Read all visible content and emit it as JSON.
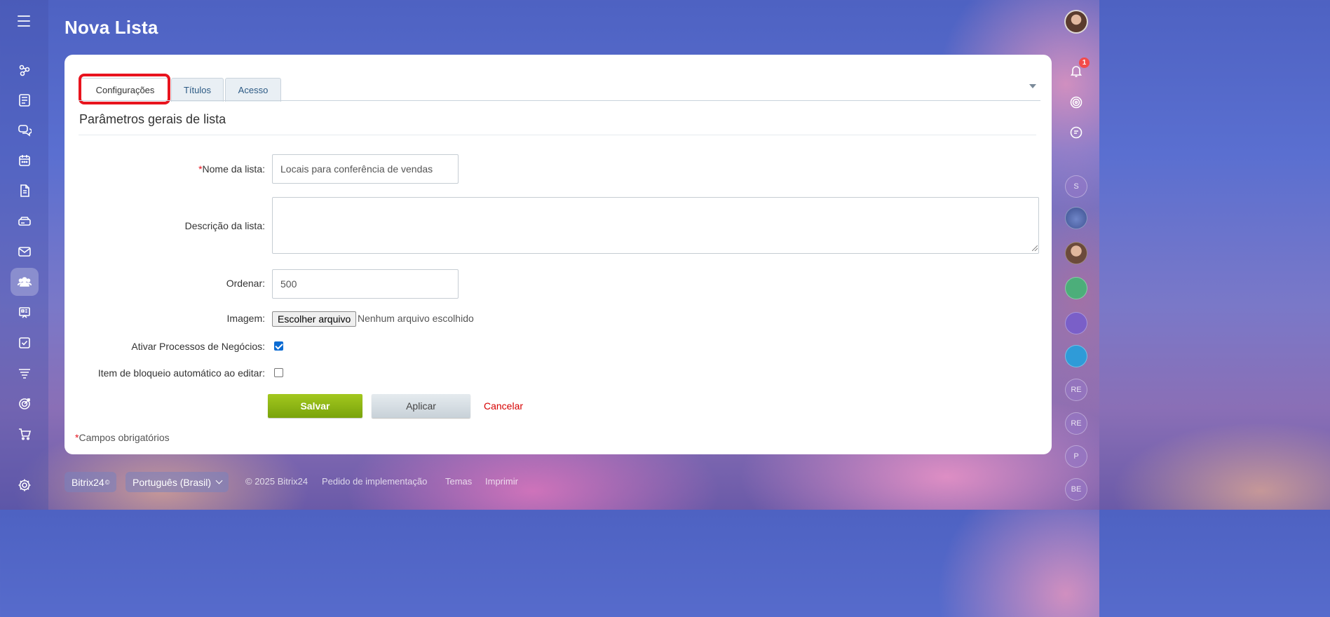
{
  "page": {
    "title": "Nova Lista"
  },
  "tabs": [
    {
      "label": "Configurações",
      "active": true
    },
    {
      "label": "Títulos",
      "active": false
    },
    {
      "label": "Acesso",
      "active": false
    }
  ],
  "section": {
    "title": "Parâmetros gerais de lista"
  },
  "form": {
    "name": {
      "required_mark": "*",
      "label": "Nome da lista:",
      "value": "Locais para conferência de vendas"
    },
    "description": {
      "label": "Descrição da lista:",
      "value": ""
    },
    "sort": {
      "label": "Ordenar:",
      "value": "500"
    },
    "image": {
      "label": "Imagem:",
      "button_label": "Escolher arquivo",
      "status": "Nenhum arquivo escolhido"
    },
    "bizproc": {
      "label": "Ativar Processos de Negócios:",
      "checked": true
    },
    "autolock": {
      "label": "Item de bloqueio automático ao editar:",
      "checked": false
    }
  },
  "buttons": {
    "save": "Salvar",
    "apply": "Aplicar",
    "cancel": "Cancelar"
  },
  "footnote": {
    "mark": "*",
    "text": "Campos obrigatórios"
  },
  "notifications": {
    "count": "1"
  },
  "right_rail": {
    "avatars": [
      "S",
      "RE",
      "RE",
      "P",
      "BE"
    ]
  },
  "footer": {
    "brand": "Bitrix24",
    "brand_suffix": "©",
    "language": "Português (Brasil)",
    "copyright": "© 2025 Bitrix24",
    "links": [
      "Pedido de implementação",
      "Temas",
      "Imprimir"
    ]
  },
  "sidebar": {
    "icons": [
      "hamburger-icon",
      "network-icon",
      "feed-icon",
      "chat-icon",
      "calendar-icon",
      "document-icon",
      "drive-icon",
      "mail-icon",
      "group-icon",
      "presentation-icon",
      "task-icon",
      "filter-icon",
      "target-icon",
      "cart-icon",
      "settings-icon"
    ]
  },
  "colors": {
    "accent_red": "#e8141e",
    "save_green": "#8db517",
    "link_blue": "#2c5a84",
    "checkbox_blue": "#0b6bd3"
  }
}
